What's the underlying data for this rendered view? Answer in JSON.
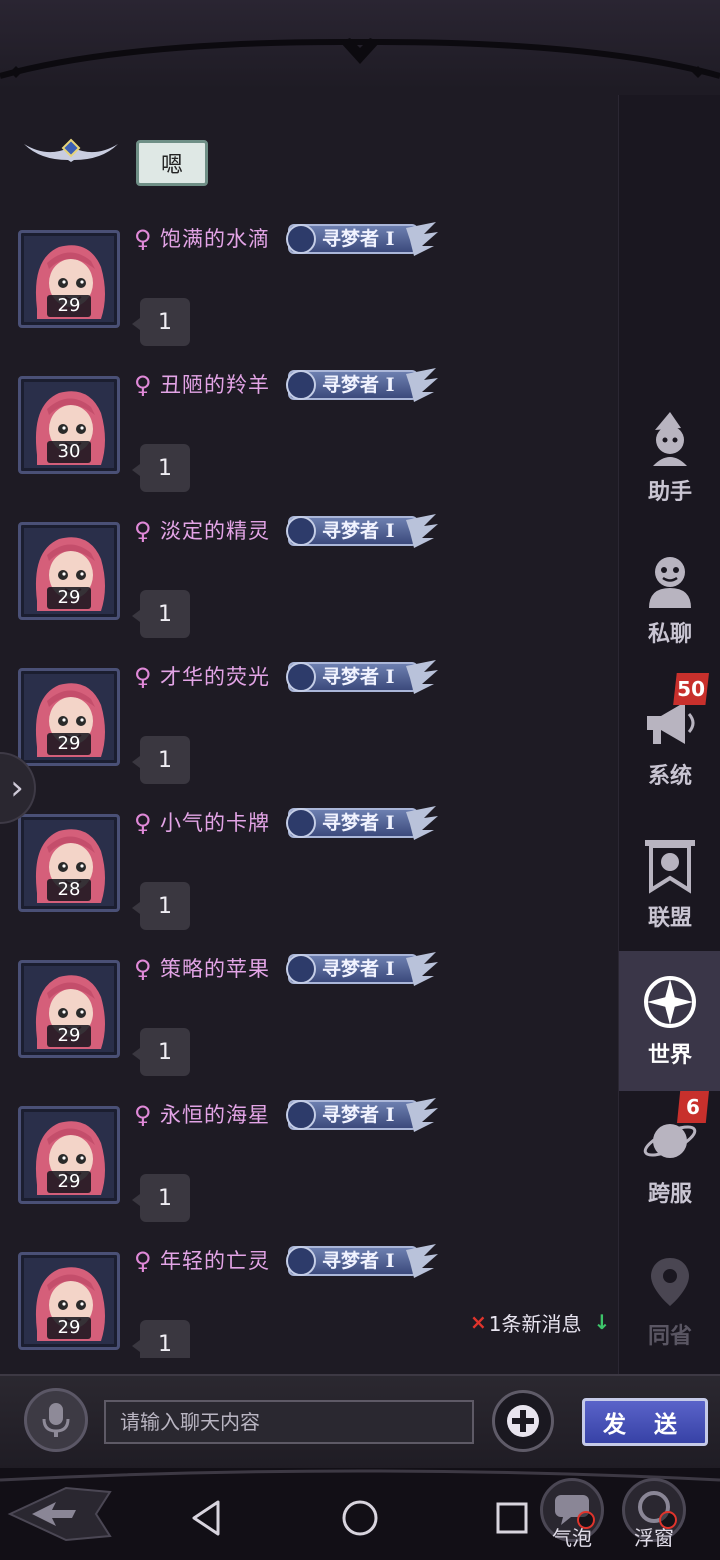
{
  "colors": {
    "name_pink": "#e3a4e6",
    "gender_pink": "#e089d8",
    "badge_red": "#c8302c",
    "send_blue": "#3742a6",
    "new_msg_arrow": "#3dc56a"
  },
  "partial_message": {
    "bubble_text": "嗯"
  },
  "messages": [
    {
      "name": "饱满的水滴",
      "level": "29",
      "title": "寻梦者 I",
      "text": "1",
      "gender": "♀"
    },
    {
      "name": "丑陋的羚羊",
      "level": "30",
      "title": "寻梦者 I",
      "text": "1",
      "gender": "♀"
    },
    {
      "name": "淡定的精灵",
      "level": "29",
      "title": "寻梦者 I",
      "text": "1",
      "gender": "♀"
    },
    {
      "name": "才华的荧光",
      "level": "29",
      "title": "寻梦者 I",
      "text": "1",
      "gender": "♀"
    },
    {
      "name": "小气的卡牌",
      "level": "28",
      "title": "寻梦者 I",
      "text": "1",
      "gender": "♀"
    },
    {
      "name": "策略的苹果",
      "level": "29",
      "title": "寻梦者 I",
      "text": "1",
      "gender": "♀"
    },
    {
      "name": "永恒的海星",
      "level": "29",
      "title": "寻梦者 I",
      "text": "1",
      "gender": "♀"
    },
    {
      "name": "年轻的亡灵",
      "level": "29",
      "title": "寻梦者 I",
      "text": "1",
      "gender": "♀"
    }
  ],
  "new_messages": {
    "x": "×",
    "text": "1条新消息",
    "arrow": "↓"
  },
  "sidebar": {
    "tabs": [
      {
        "label": "助手",
        "icon": "assistant-icon",
        "badge": ""
      },
      {
        "label": "私聊",
        "icon": "private-chat-icon",
        "badge": ""
      },
      {
        "label": "系统",
        "icon": "megaphone-icon",
        "badge": "50"
      },
      {
        "label": "联盟",
        "icon": "alliance-banner-icon",
        "badge": ""
      },
      {
        "label": "世界",
        "icon": "compass-icon",
        "badge": "",
        "active": true
      },
      {
        "label": "跨服",
        "icon": "planet-icon",
        "badge": "6"
      },
      {
        "label": "同省",
        "icon": "location-pin-icon",
        "badge": "",
        "disabled": true
      }
    ]
  },
  "input_bar": {
    "placeholder": "请输入聊天内容",
    "send_label": "发 送"
  },
  "bottom_nav": {
    "bubble_label": "气泡",
    "float_label": "浮窗"
  },
  "drawer_handle": {
    "glyph": "›"
  }
}
